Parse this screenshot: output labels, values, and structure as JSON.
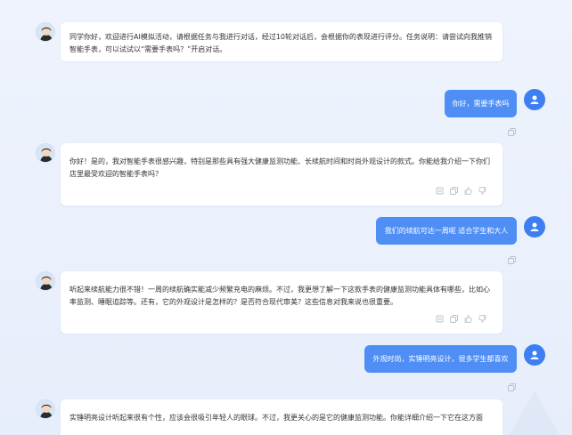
{
  "messages": [
    {
      "role": "ai",
      "text": "同学你好，欢迎进行AI模拟活动，请根据任务与我进行对话，经过10轮对话后，会根据你的表现进行评分。任务说明：请尝试向我推销智能手表，可以试试以“需要手表吗？”开启对话。"
    },
    {
      "role": "user",
      "text": "你好，需要手表吗"
    },
    {
      "role": "ai",
      "text": "你好！是的，我对智能手表很感兴趣，特别是那些具有强大健康监测功能、长续航时间和时尚外观设计的款式。你能给我介绍一下你们店里最受欢迎的智能手表吗？"
    },
    {
      "role": "user",
      "text": "我们的续航可达一周呢 适合学生和大人"
    },
    {
      "role": "ai",
      "text": "听起来续航能力很不错！一周的续航确实能减少频繁充电的麻烦。不过，我更想了解一下这款手表的健康监测功能具体有哪些，比如心率监测、睡眠追踪等。还有，它的外观设计是怎样的？是否符合现代审美？这些信息对我来说也很重要。"
    },
    {
      "role": "user",
      "text": "外观时尚，实锤明亮设计，很多学生都喜欢"
    },
    {
      "role": "ai",
      "text": "实锤明亮设计听起来很有个性，应该会很吸引年轻人的眼球。不过，我更关心的是它的健康监测功能。你能详细介绍一下它在这方面"
    }
  ],
  "icons": {
    "copy": "copy-icon",
    "reload": "refresh-icon",
    "like": "thumbs-up-icon",
    "dislike": "thumbs-down-icon",
    "user": "user-icon"
  },
  "colors": {
    "user_bubble": "#4e8ef5",
    "user_avatar": "#3d7ff2",
    "background": "#eaf0fc"
  }
}
